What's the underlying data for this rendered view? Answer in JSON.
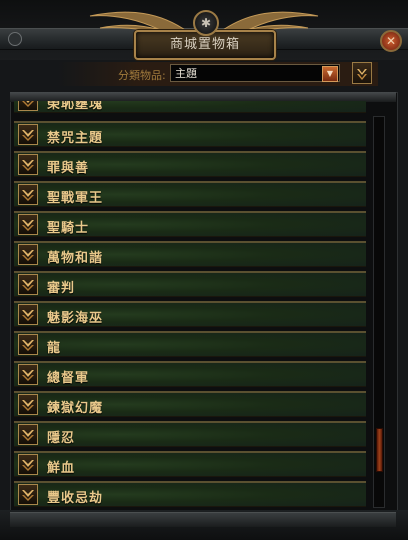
{
  "window": {
    "title": "商城置物箱",
    "close_glyph": "✕",
    "medallion_glyph": "✱"
  },
  "filter": {
    "label": "分類物品:",
    "selected": "主題",
    "dropdown_icon": "dropdown-arrow-icon"
  },
  "list": {
    "items": [
      {
        "label": "禁咒主題"
      },
      {
        "label": "罪與善"
      },
      {
        "label": "聖戰軍王"
      },
      {
        "label": "聖騎士"
      },
      {
        "label": "萬物和諧"
      },
      {
        "label": "審判"
      },
      {
        "label": "魅影海巫"
      },
      {
        "label": "龍"
      },
      {
        "label": "總督軍"
      },
      {
        "label": "鍊獄幻魔"
      },
      {
        "label": "隱忍"
      },
      {
        "label": "鮮血"
      },
      {
        "label": "豐收忌劫"
      }
    ],
    "partial_item_label": "榮恥壅塊",
    "row_icon": "chevron-down-icon"
  },
  "scrollbar": {
    "position": 0.82
  },
  "colors": {
    "accent_gold": "#e9c98b",
    "frame_gold": "#a8874c",
    "row_green": "#1a2b16",
    "scroll_thumb": "#a0421a"
  }
}
